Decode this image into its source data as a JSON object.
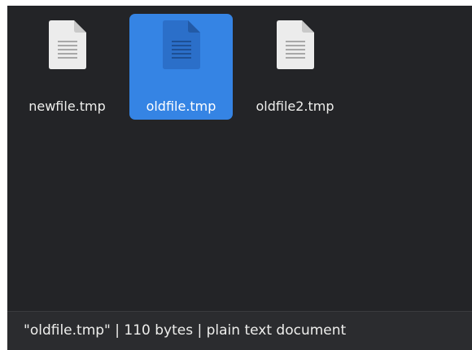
{
  "files": [
    {
      "name": "newfile.tmp",
      "icon": "text-document-icon",
      "selected": false
    },
    {
      "name": "oldfile.tmp",
      "icon": "text-document-icon",
      "selected": true
    },
    {
      "name": "oldfile2.tmp",
      "icon": "text-document-icon",
      "selected": false
    }
  ],
  "statusbar": {
    "text": "\"oldfile.tmp\" | 110 bytes | plain text document"
  },
  "colors": {
    "background": "#232427",
    "selection": "#3584e4",
    "document_icon": "#ececec",
    "document_icon_selected": "#2b6fc9",
    "text": "#eeeeec"
  }
}
